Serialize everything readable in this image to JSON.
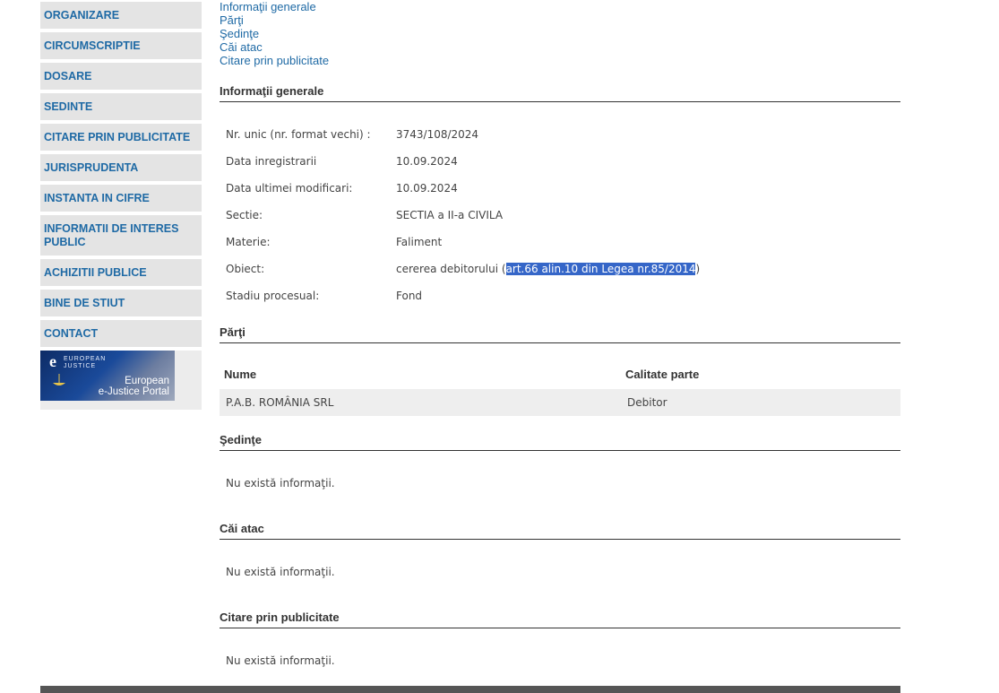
{
  "sidebar": {
    "items": [
      {
        "label": "ORGANIZARE"
      },
      {
        "label": "CIRCUMSCRIPTIE"
      },
      {
        "label": "DOSARE"
      },
      {
        "label": "SEDINTE"
      },
      {
        "label": "CITARE PRIN PUBLICITATE"
      },
      {
        "label": "JURISPRUDENTA"
      },
      {
        "label": "INSTANTA IN CIFRE"
      },
      {
        "label": "INFORMATII DE INTERES PUBLIC"
      },
      {
        "label": "ACHIZITII PUBLICE"
      },
      {
        "label": "BINE DE STIUT"
      },
      {
        "label": "CONTACT"
      }
    ],
    "banner": {
      "logo_small_1": "EUROPEAN",
      "logo_small_2": "JUSTICE",
      "logo_e": "e",
      "portal_line1": "European",
      "portal_line2": "e-Justice Portal"
    }
  },
  "anchors": [
    "Informaţii generale",
    "Părţi",
    "Şedinţe",
    "Căi atac",
    "Citare prin publicitate"
  ],
  "sections": {
    "info": "Informaţii generale",
    "parti": "Părţi",
    "sedinte": "Şedinţe",
    "cai_atac": "Căi atac",
    "citare": "Citare prin publicitate"
  },
  "info_rows": [
    {
      "label": "Nr. unic (nr. format vechi) :",
      "value": "3743/108/2024"
    },
    {
      "label": "Data inregistrarii",
      "value": "10.09.2024"
    },
    {
      "label": "Data ultimei modificari:",
      "value": "10.09.2024"
    },
    {
      "label": "Sectie:",
      "value": "SECTIA a II-a CIVILA"
    },
    {
      "label": "Materie:",
      "value": "Faliment"
    },
    {
      "label": "Obiect:",
      "value_pre": "cererea debitorului (",
      "value_hl": "art.66 alin.10 din Legea nr.85/2014",
      "value_post": ")"
    },
    {
      "label": "Stadiu procesual:",
      "value": "Fond"
    }
  ],
  "parti_table": {
    "headers": [
      "Nume",
      "Calitate parte"
    ],
    "rows": [
      [
        "P.A.B. ROMÂNIA SRL",
        "Debitor"
      ]
    ]
  },
  "empty_msg": "Nu există informaţii."
}
